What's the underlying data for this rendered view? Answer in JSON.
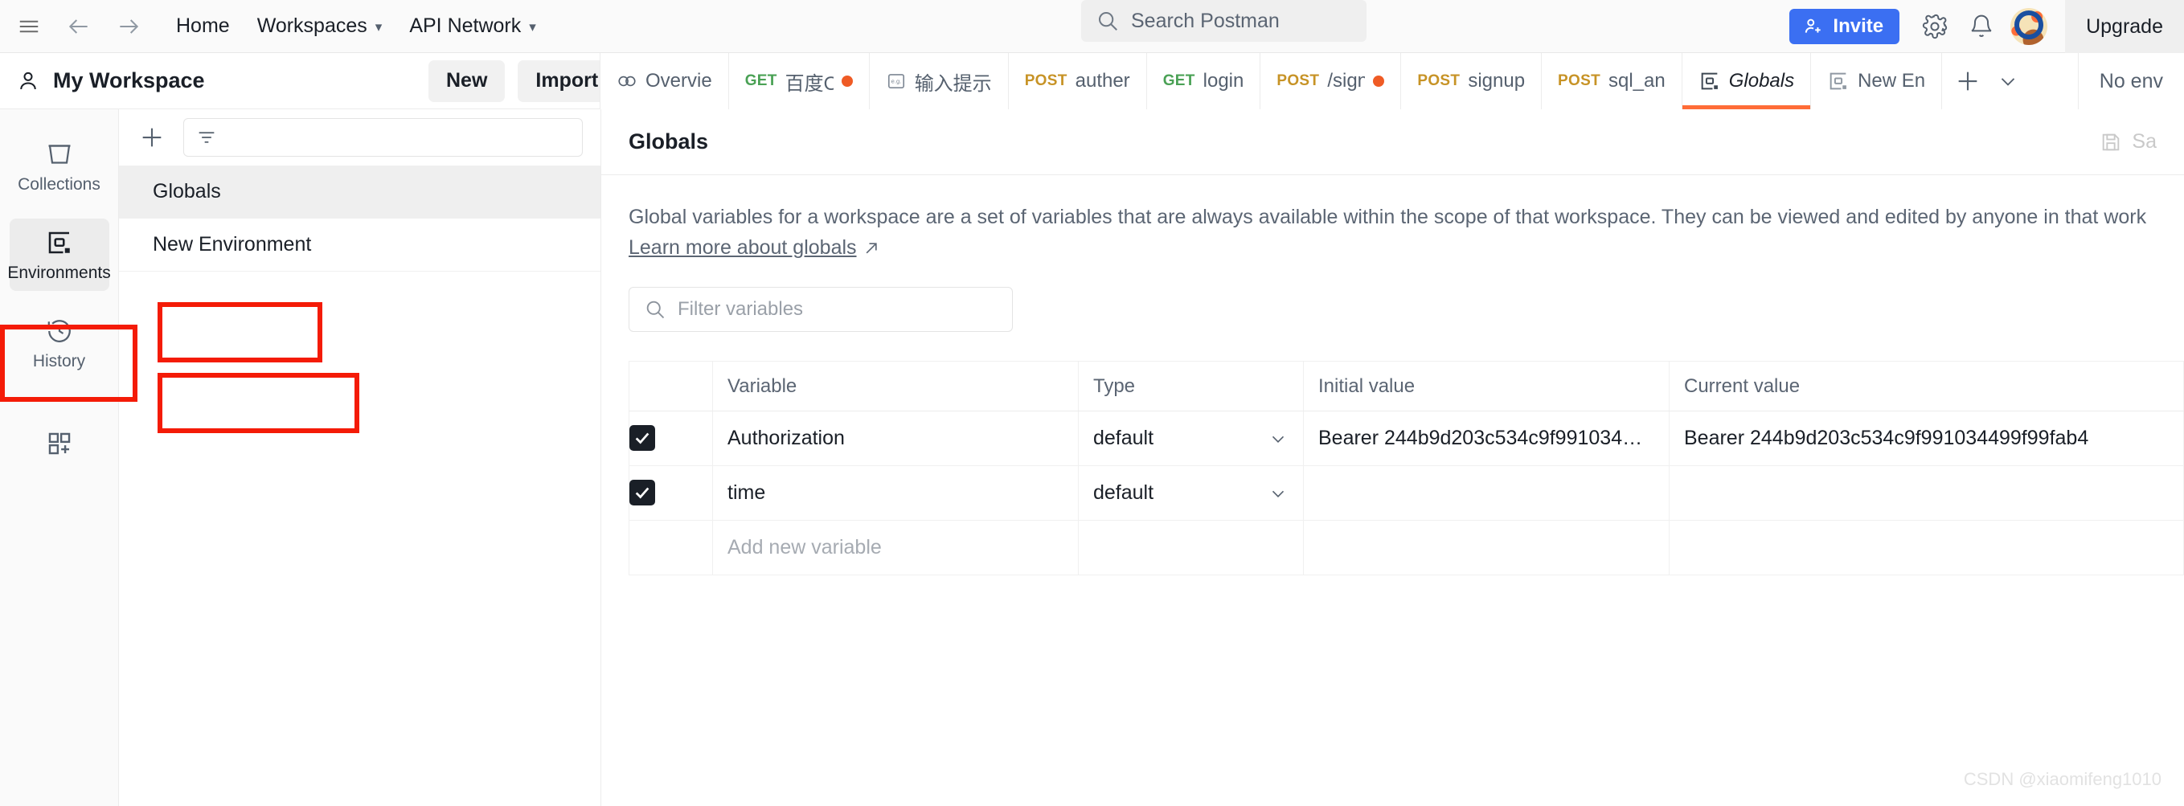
{
  "topbar": {
    "hamburger_icon": "hamburger-menu-icon",
    "back_icon": "arrow-left-icon",
    "forward_icon": "arrow-right-icon",
    "home": "Home",
    "workspaces": "Workspaces",
    "api_network": "API Network",
    "search_placeholder": "Search Postman",
    "invite": "Invite",
    "settings_icon": "gear-icon",
    "notifications_icon": "bell-icon",
    "avatar": "user-avatar",
    "upgrade": "Upgrade",
    "invite_color": "#3b6ff2"
  },
  "workspace": {
    "title": "My Workspace",
    "new_label": "New",
    "import_label": "Import"
  },
  "tabs": {
    "items": [
      {
        "method": "",
        "label": "Overvie",
        "icon": "overview-icon",
        "unsaved": false,
        "active": false
      },
      {
        "method": "GET",
        "label": "百度O(",
        "icon": "",
        "unsaved": true,
        "active": false
      },
      {
        "method": "",
        "label": "输入提示",
        "icon": "example-icon",
        "unsaved": false,
        "active": false
      },
      {
        "method": "POST",
        "label": "auther",
        "icon": "",
        "unsaved": false,
        "active": false
      },
      {
        "method": "GET",
        "label": "login",
        "icon": "",
        "unsaved": false,
        "active": false
      },
      {
        "method": "POST",
        "label": "/signu",
        "icon": "",
        "unsaved": true,
        "active": false
      },
      {
        "method": "POST",
        "label": "signup",
        "icon": "",
        "unsaved": false,
        "active": false
      },
      {
        "method": "POST",
        "label": "sql_an",
        "icon": "",
        "unsaved": false,
        "active": false
      },
      {
        "method": "",
        "label": "Globals",
        "icon": "environment-icon",
        "unsaved": false,
        "active": true
      },
      {
        "method": "",
        "label": "New En",
        "icon": "environment-icon",
        "unsaved": false,
        "active": false
      }
    ],
    "new_tab_icon": "plus-icon",
    "tab_list_icon": "chevron-down-icon",
    "no_environment": "No env"
  },
  "rail": {
    "items": [
      {
        "label": "Collections",
        "icon": "collections-icon",
        "selected": false
      },
      {
        "label": "Environments",
        "icon": "environment-icon",
        "selected": true
      },
      {
        "label": "History",
        "icon": "history-clock-icon",
        "selected": false
      }
    ],
    "apps_icon": "add-apps-grid-icon"
  },
  "env_panel": {
    "create_icon": "plus-icon",
    "filter_icon": "filter-icon",
    "filter_placeholder": "",
    "items": [
      {
        "label": "Globals",
        "selected": true
      },
      {
        "label": "New Environment",
        "selected": false
      }
    ]
  },
  "main": {
    "title": "Globals",
    "save_label": "Sa",
    "save_icon": "floppy-disk-save-icon",
    "description": "Global variables for a workspace are a set of variables that are always available within the scope of that workspace. They can be viewed and edited by anyone in that work",
    "learn_more": "Learn more about globals",
    "external_link_icon": "external-link-arrow-icon",
    "filter_placeholder": "Filter variables",
    "search_icon": "search-icon",
    "table": {
      "headers": [
        "",
        "Variable",
        "Type",
        "Initial value",
        "Current value"
      ],
      "rows": [
        {
          "checked": true,
          "variable": "Authorization",
          "type": "default",
          "initial_value": "Bearer 244b9d203c534c9f991034…",
          "current_value": "Bearer 244b9d203c534c9f991034499f99fab4"
        },
        {
          "checked": true,
          "variable": "time",
          "type": "default",
          "initial_value": "",
          "current_value": ""
        }
      ],
      "add_new_placeholder": "Add new variable",
      "type_caret_icon": "chevron-down-icon"
    }
  },
  "annotations": {
    "color": "#f41b07",
    "boxes": [
      "environments-rail-item",
      "globals-list-item",
      "new-environment-list-item"
    ]
  },
  "watermark": "CSDN @xiaomifeng1010"
}
